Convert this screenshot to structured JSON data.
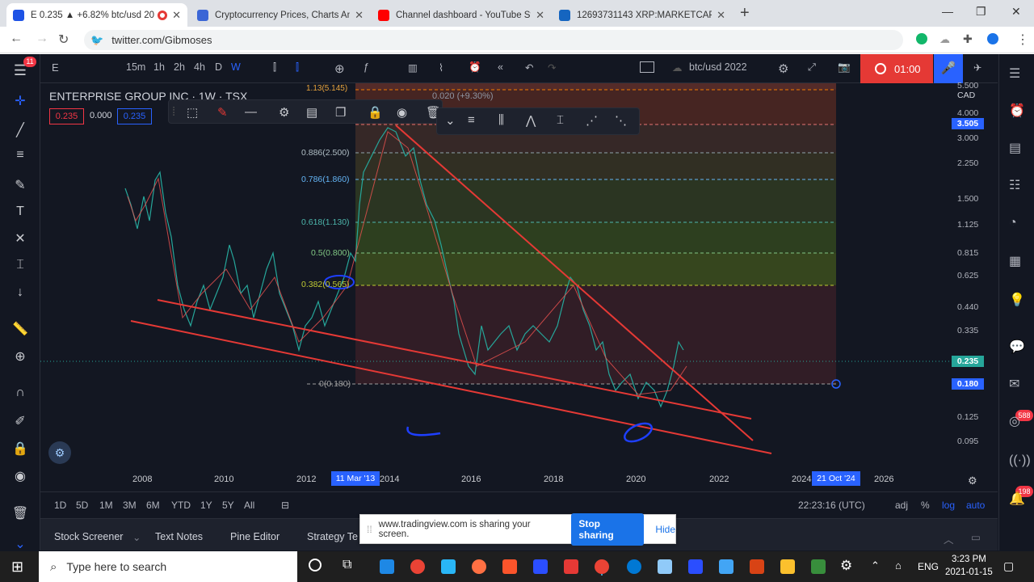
{
  "browser": {
    "tabs": [
      {
        "label": "E 0.235 ▲ +6.82% btc/usd 20",
        "color": "#1e53e5",
        "active": true
      },
      {
        "label": "Cryptocurrency Prices, Charts An",
        "color": "#3b66d6",
        "active": false
      },
      {
        "label": "Channel dashboard - YouTube St",
        "color": "#ff0000",
        "active": false
      },
      {
        "label": "12693731143 XRP:MARKETCAP -",
        "color": "#1565c0",
        "active": false
      }
    ],
    "new_tab": "+",
    "url": "twitter.com/Gibmoses",
    "window_controls": [
      "—",
      "❐",
      "✕"
    ]
  },
  "tv": {
    "menu_badge": "11",
    "intervals": [
      "15m",
      "1h",
      "2h",
      "4h",
      "D",
      "W"
    ],
    "symbol_search": "btc/usd 2022",
    "timer": "01:00",
    "symbol_title": "ENTERPRISE GROUP INC · 1W · TSX",
    "prices": {
      "bid": "0.235",
      "spread": "0.000",
      "ask": "0.235"
    },
    "change_label": "0.020 (+9.30%)",
    "currency": "CAD",
    "price_scale": [
      "5.500",
      "4.000",
      "3.000",
      "2.250",
      "1.500",
      "1.125",
      "0.815",
      "0.625",
      "0.440",
      "0.335",
      "0.125",
      "0.095"
    ],
    "price_tags": [
      {
        "label": "3.505",
        "color": "#2962ff"
      },
      {
        "label": "0.235",
        "color": "#26a69a"
      },
      {
        "label": "0.180",
        "color": "#2962ff"
      }
    ],
    "fib_levels": [
      "1.13(5.145)",
      "0.886(2.500)",
      "0.786(1.860)",
      "0.618(1.130)",
      "0.5(0.800)",
      "0.382(0.565)",
      "0(0.180)"
    ],
    "years": [
      "2008",
      "2010",
      "2012",
      "2014",
      "2016",
      "2018",
      "2020",
      "2022",
      "2024",
      "2026"
    ],
    "time_tags": [
      "11 Mar '13",
      "21 Oct '24"
    ],
    "ranges": [
      "1D",
      "5D",
      "1M",
      "3M",
      "6M",
      "YTD",
      "1Y",
      "5Y",
      "All"
    ],
    "clock": "22:23:16 (UTC)",
    "scale_opts": [
      "adj",
      "%",
      "log",
      "auto"
    ],
    "bottom_tabs": [
      "Stock Screener",
      "Text Notes",
      "Pine Editor",
      "Strategy Te"
    ],
    "right_badges": [
      "588",
      "198"
    ]
  },
  "share": {
    "message": "www.tradingview.com is sharing your screen.",
    "stop": "Stop sharing",
    "hide": "Hide"
  },
  "taskbar": {
    "search_placeholder": "Type here to search",
    "lang": "ENG",
    "time": "3:23 PM",
    "date": "2021-01-15"
  }
}
